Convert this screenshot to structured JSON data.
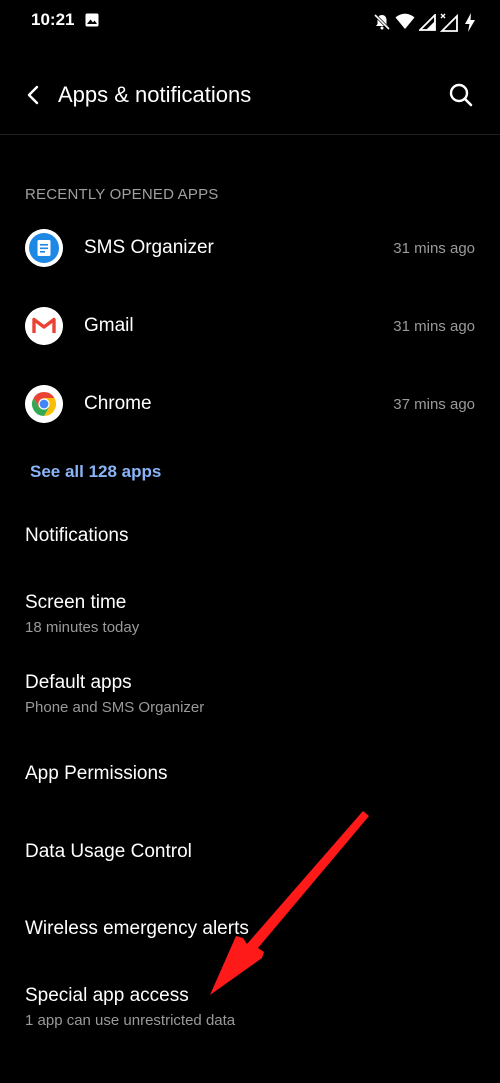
{
  "status_bar": {
    "time": "10:21",
    "icons": [
      "image-icon",
      "bell-off-icon",
      "wifi-icon",
      "signal-icon",
      "signal-no-data-icon",
      "charging-icon"
    ]
  },
  "toolbar": {
    "title": "Apps & notifications",
    "back_icon": "back-arrow-icon",
    "search_icon": "search-icon"
  },
  "recent_apps": {
    "header": "RECENTLY OPENED APPS",
    "items": [
      {
        "name": "SMS Organizer",
        "time": "31 mins ago",
        "icon": "sms-organizer-icon"
      },
      {
        "name": "Gmail",
        "time": "31 mins ago",
        "icon": "gmail-icon"
      },
      {
        "name": "Chrome",
        "time": "37 mins ago",
        "icon": "chrome-icon"
      }
    ],
    "see_all": "See all 128 apps"
  },
  "settings": [
    {
      "title": "Notifications",
      "subtitle": ""
    },
    {
      "title": "Screen time",
      "subtitle": "18 minutes today"
    },
    {
      "title": "Default apps",
      "subtitle": "Phone and SMS Organizer"
    },
    {
      "title": "App Permissions",
      "subtitle": ""
    },
    {
      "title": "Data Usage Control",
      "subtitle": ""
    },
    {
      "title": "Wireless emergency alerts",
      "subtitle": ""
    },
    {
      "title": "Special app access",
      "subtitle": "1 app can use unrestricted data"
    }
  ],
  "annotation": {
    "arrow_color": "#ff1a1a"
  },
  "colors": {
    "background": "#000000",
    "link": "#8ab4f8",
    "secondary_text": "#9a9a9a"
  }
}
